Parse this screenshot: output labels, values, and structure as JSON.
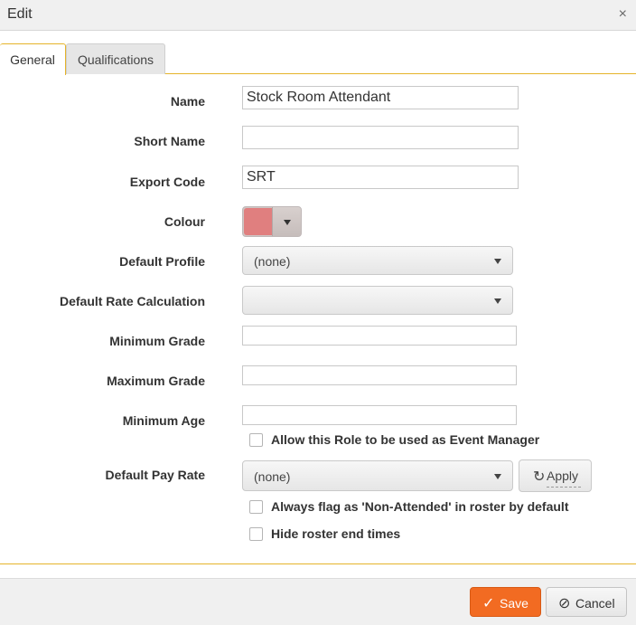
{
  "dialog": {
    "title": "Edit",
    "close_label": "×"
  },
  "tabs": [
    {
      "label": "General",
      "active": true
    },
    {
      "label": "Qualifications",
      "active": false
    }
  ],
  "form": {
    "name": {
      "label": "Name",
      "value": "Stock Room Attendant"
    },
    "short_name": {
      "label": "Short Name",
      "value": ""
    },
    "export_code": {
      "label": "Export Code",
      "value": "SRT"
    },
    "colour": {
      "label": "Colour",
      "value": "#e07f7f"
    },
    "default_profile": {
      "label": "Default Profile",
      "value": "(none)"
    },
    "default_rate_calc": {
      "label": "Default Rate Calculation",
      "value": ""
    },
    "min_grade": {
      "label": "Minimum Grade",
      "value": ""
    },
    "max_grade": {
      "label": "Maximum Grade",
      "value": ""
    },
    "min_age": {
      "label": "Minimum Age",
      "value": ""
    },
    "event_manager": {
      "label": "Allow this Role to be used as Event Manager",
      "checked": false
    },
    "default_pay_rate": {
      "label": "Default Pay Rate",
      "value": "(none)"
    },
    "apply_label": "Apply",
    "non_attended": {
      "label": "Always flag as 'Non-Attended' in roster by default",
      "checked": false
    },
    "hide_end_times": {
      "label": "Hide roster end times",
      "checked": false
    }
  },
  "footer": {
    "save_label": "Save",
    "cancel_label": "Cancel"
  },
  "colors": {
    "accent": "#e5b42a",
    "save": "#f26b22"
  }
}
